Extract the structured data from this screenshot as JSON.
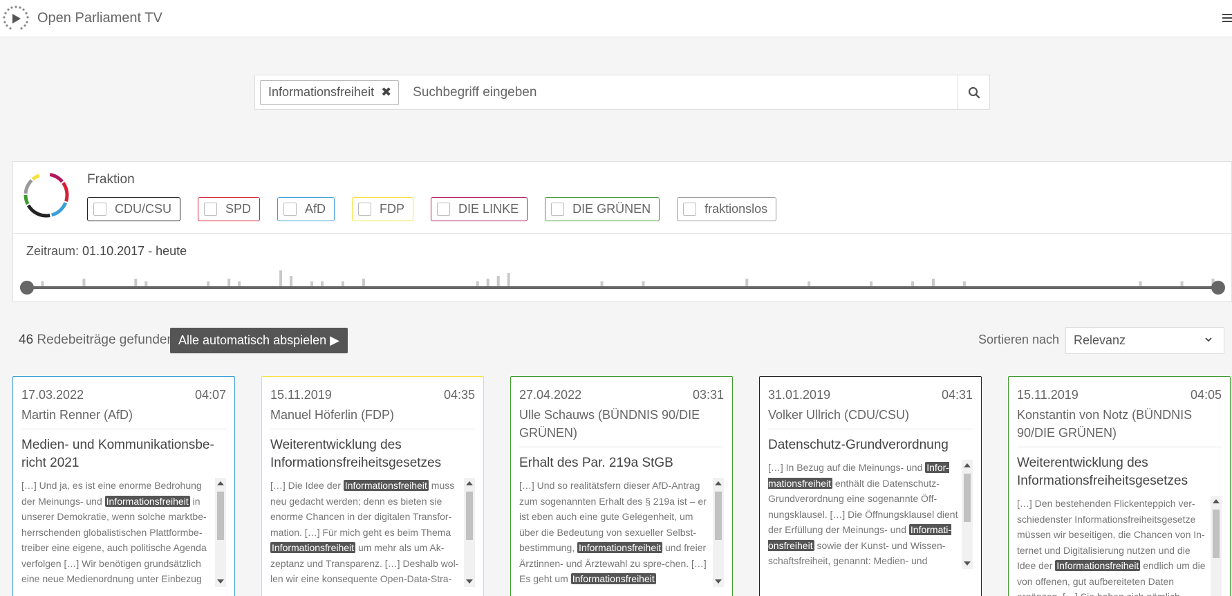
{
  "header": {
    "brand": "Open Parliament TV"
  },
  "search": {
    "tag": "Informationsfreiheit",
    "placeholder": "Suchbegriff eingeben"
  },
  "filters": {
    "fraktion_label": "Fraktion",
    "parties": [
      {
        "name": "CDU/CSU",
        "color": "#222222"
      },
      {
        "name": "SPD",
        "color": "#d71f36"
      },
      {
        "name": "AfD",
        "color": "#3a9fd8"
      },
      {
        "name": "FDP",
        "color": "#f5e13c"
      },
      {
        "name": "DIE LINKE",
        "color": "#b0185e"
      },
      {
        "name": "DIE GRÜNEN",
        "color": "#3f9a2e"
      },
      {
        "name": "fraktionslos",
        "color": "#999999"
      }
    ],
    "zeitraum_label": "Zeitraum:",
    "zeitraum_value": "01.10.2017 - heute"
  },
  "results": {
    "count": "46",
    "count_label": "Redebeiträge gefunden",
    "play_all": "Alle automatisch abspielen ▶",
    "sort_label": "Sortieren nach",
    "sort_value": "Relevanz"
  },
  "cards": [
    {
      "date": "17.03.2022",
      "duration": "04:07",
      "speaker": "Martin Renner (AfD)",
      "title": "Medien- und Kommunikationsbe-richt 2021",
      "color": "#3a9fd8",
      "snippet": [
        {
          "t": "[…] Und ja, es ist eine enorme Bedrohung der Meinungs- und "
        },
        {
          "t": "Informationsfreiheit",
          "hl": true
        },
        {
          "t": " in unserer Demokratie, wenn solche marktbe-herrschenden globalistischen Plattformbe-treiber eine eigene, auch politische Agenda verfolgen […] Wir benötigen grundsätzlich eine neue Medienordnung unter Einbezug"
        }
      ]
    },
    {
      "date": "15.11.2019",
      "duration": "04:35",
      "speaker": "Manuel Höferlin (FDP)",
      "title": "Weiterentwicklung des Informationsfreiheitsgesetzes",
      "color": "#f5e13c",
      "snippet": [
        {
          "t": "[…] Die Idee der "
        },
        {
          "t": "Informationsfreiheit",
          "hl": true
        },
        {
          "t": " muss neu gedacht werden; denn es bieten sie enorme Chancen in der digitalen Transfor-mation. […] Für mich geht es beim Thema "
        },
        {
          "t": "Informationsfreiheit",
          "hl": true
        },
        {
          "t": " um mehr als um Ak-zeptanz und Transparenz. […] Deshalb wol-len wir eine konsequente Open-Data-Stra-"
        }
      ]
    },
    {
      "date": "27.04.2022",
      "duration": "03:31",
      "speaker": "Ulle Schauws (BÜNDNIS 90/DIE GRÜNEN)",
      "title": "Erhalt des Par. 219a StGB",
      "color": "#3f9a2e",
      "snippet": [
        {
          "t": "[…] Und so realitätsfern dieser AfD-Antrag zum sogenannten Erhalt des § 219a ist – er ist eben auch eine gute Gelegenheit, um über die Bedeutung von sexueller Selbst-bestimmung, "
        },
        {
          "t": "Informationsfreiheit",
          "hl": true
        },
        {
          "t": " und freier Ärztinnen- und Ärztewahl zu spre-chen. […] Es geht um "
        },
        {
          "t": "Informationsfreiheit",
          "hl": true
        }
      ]
    },
    {
      "date": "31.01.2019",
      "duration": "04:31",
      "speaker": "Volker Ullrich (CDU/CSU)",
      "title": "Datenschutz-Grundverordnung",
      "color": "#222222",
      "snippet": [
        {
          "t": "[…] In Bezug auf die Meinungs- und "
        },
        {
          "t": "Infor-mationsfreiheit",
          "hl": true
        },
        {
          "t": " enthält die Datenschutz-Grundverordnung eine sogenannte Öff-nungsklausel. […] Die Öffnungsklausel dient der Erfüllung der Meinungs- und "
        },
        {
          "t": "Informati-onsfreiheit",
          "hl": true
        },
        {
          "t": " sowie der Kunst- und Wissen-schaftsfreiheit, genannt: Medien- und"
        }
      ]
    },
    {
      "date": "15.11.2019",
      "duration": "04:05",
      "speaker": "Konstantin von Notz (BÜNDNIS 90/DIE GRÜNEN)",
      "title": "Weiterentwicklung des Informationsfreiheitsgesetzes",
      "color": "#3f9a2e",
      "snippet": [
        {
          "t": "[…] Den bestehenden Flickenteppich ver-schiedenster Informationsfreiheitsgesetze müssen wir beseitigen, die Chancen von In-ternet und Digitalisierung nutzen und die Idee der "
        },
        {
          "t": "Informationsfreiheit",
          "hl": true
        },
        {
          "t": " endlich um die von offenen, gut aufbereiteten Daten ergänzen. […] Sie haben sich nämlich selbst"
        }
      ]
    }
  ],
  "timeline": {
    "note": "relative speech counts per time bucket",
    "bars": [
      0,
      2,
      0,
      0,
      0,
      3,
      0,
      0,
      0,
      0,
      3,
      2,
      0,
      0,
      0,
      0,
      0,
      2,
      0,
      3,
      2,
      0,
      0,
      0,
      6,
      4,
      0,
      2,
      2,
      0,
      2,
      0,
      3,
      0,
      0,
      0,
      0,
      0,
      0,
      0,
      0,
      0,
      0,
      2,
      3,
      4,
      5,
      0,
      0,
      0,
      0,
      0,
      0,
      0,
      0,
      2,
      0,
      0,
      0,
      2,
      0,
      0,
      0,
      0,
      0,
      0,
      0,
      0,
      0,
      3,
      0,
      0,
      0,
      0,
      0,
      2,
      0,
      0,
      0,
      0,
      0,
      2,
      0,
      0,
      0,
      2,
      0,
      3,
      0,
      0,
      2,
      0,
      0,
      0,
      0,
      0,
      0,
      0,
      0,
      0,
      0,
      0,
      0,
      0,
      0,
      0,
      0,
      2,
      0,
      0,
      0,
      2,
      0,
      0,
      3
    ]
  }
}
